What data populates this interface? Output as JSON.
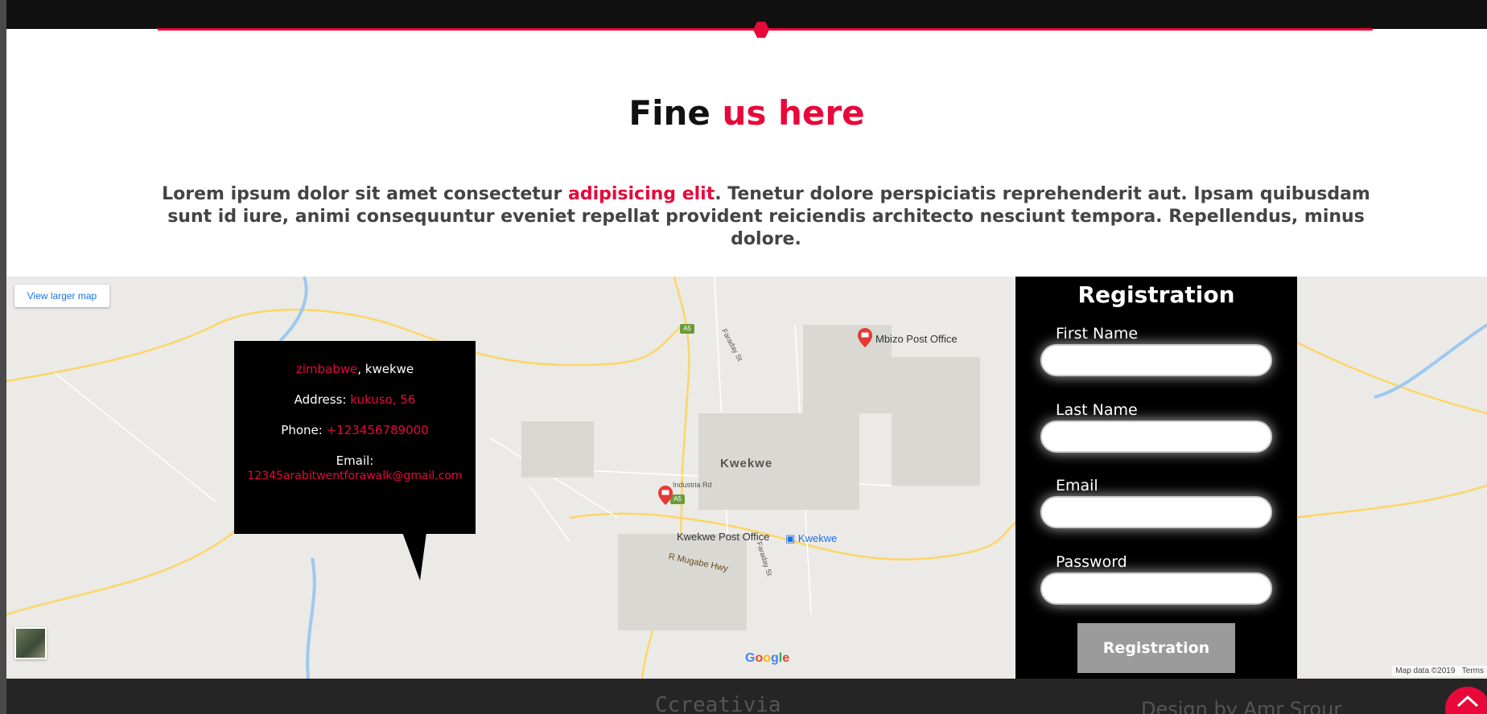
{
  "section": {
    "title_plain": "Fine",
    "title_accent": "us here",
    "intro_before": "Lorem ipsum dolor sit amet consectetur",
    "intro_accent": "adipisicing elit",
    "intro_after": ". Tenetur dolore perspiciatis reprehenderit aut. Ipsam quibusdam sunt id iure, animi consequuntur eveniet repellat provident reiciendis architecto nesciunt tempora. Repellendus, minus dolore."
  },
  "map": {
    "view_larger": "View larger map",
    "town": "Kwekwe",
    "places": {
      "mbizo": "Mbizo Post Office",
      "kwekwe_po": "Kwekwe Post Office",
      "kwekwe_station": "Kwekwe",
      "industria": "Industria Rd",
      "mugabe": "R Mugabe Hwy",
      "faraday1": "Faraday St",
      "faraday2": "Faraday St"
    },
    "road_badges": {
      "a5_top": "A5",
      "a5_mid": "A5"
    },
    "google": "Google",
    "credit": "Map data ©2019",
    "terms": "Terms"
  },
  "info": {
    "country": "zimbabwe",
    "city": ", kwekwe",
    "address_label": "Address:",
    "address_value": "kukuso, 56",
    "phone_label": "Phone:",
    "phone_value": "+123456789000",
    "email_label": "Email:",
    "email_value": "12345arabitwentforawalk@gmail.com"
  },
  "registration": {
    "title": "Registration",
    "first_name": "First Name",
    "last_name": "Last Name",
    "email": "Email",
    "password": "Password",
    "submit": "Registration"
  },
  "footer": {
    "brand": "Ccreativia",
    "credit": "Design by Amr Srour"
  },
  "colors": {
    "accent": "#e8083a",
    "panel": "#000000",
    "footer": "#252525"
  },
  "icons": {
    "scroll_top": "chevron-up-icon",
    "post_pin": "mail-pin-icon"
  }
}
